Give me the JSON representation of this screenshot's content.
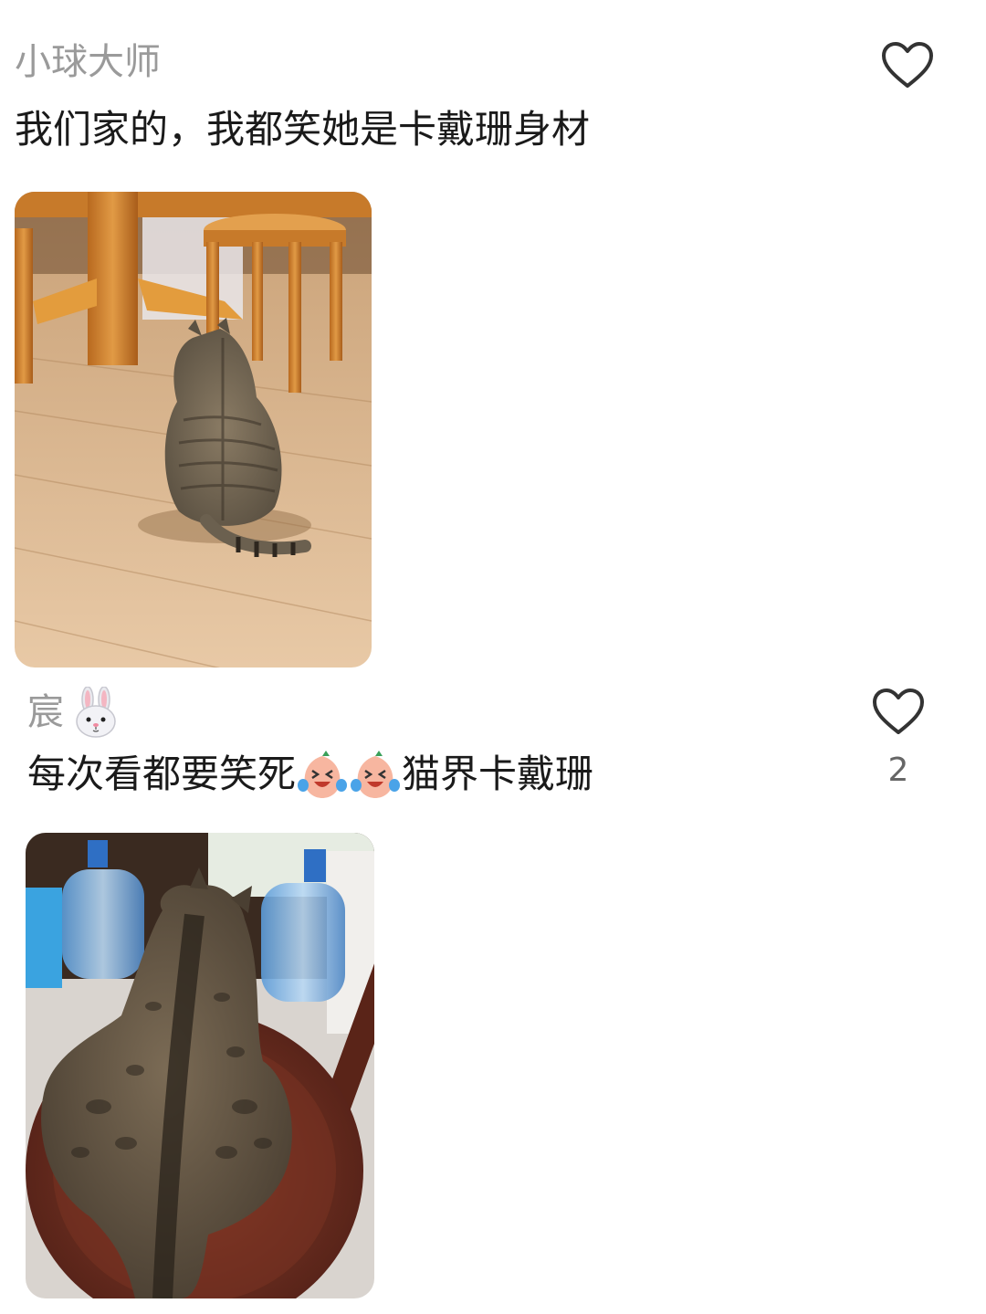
{
  "comments": [
    {
      "username": "小球大师",
      "text": "我们家的，我都笑她是卡戴珊身材",
      "likes": ""
    },
    {
      "username": "宸",
      "username_badge_icon": "rabbit-face-emoji",
      "text_before_emoji": "每次看都要笑死",
      "emoji_icons": [
        "crying-laughing-emoji",
        "crying-laughing-emoji"
      ],
      "text_after_emoji": "猫界卡戴珊",
      "likes": "2"
    }
  ],
  "colors": {
    "username": "#9a9a9a",
    "text": "#1a1a1a",
    "like_count": "#666666",
    "heart_outline": "#333333"
  }
}
